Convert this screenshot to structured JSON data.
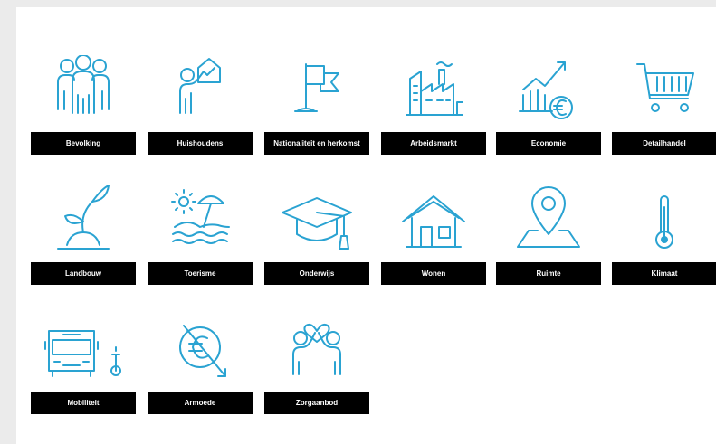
{
  "accent_color": "#2aa3d2",
  "tiles": [
    {
      "label": "Bevolking",
      "icon": "people-group-icon"
    },
    {
      "label": "Huishoudens",
      "icon": "person-holding-house-icon"
    },
    {
      "label": "Nationaliteit en herkomst",
      "icon": "flag-icon"
    },
    {
      "label": "Arbeidsmarkt",
      "icon": "factory-icon"
    },
    {
      "label": "Economie",
      "icon": "growth-chart-euro-icon"
    },
    {
      "label": "Detailhandel",
      "icon": "shopping-cart-icon"
    },
    {
      "label": "Landbouw",
      "icon": "plant-sprout-icon"
    },
    {
      "label": "Toerisme",
      "icon": "beach-umbrella-icon"
    },
    {
      "label": "Onderwijs",
      "icon": "graduation-cap-icon"
    },
    {
      "label": "Wonen",
      "icon": "house-icon"
    },
    {
      "label": "Ruimte",
      "icon": "map-pin-icon"
    },
    {
      "label": "Klimaat",
      "icon": "thermometer-icon"
    },
    {
      "label": "Mobiliteit",
      "icon": "bus-and-bicycle-icon"
    },
    {
      "label": "Armoede",
      "icon": "euro-crossed-arrow-icon"
    },
    {
      "label": "Zorgaanbod",
      "icon": "people-with-heart-icon"
    }
  ]
}
